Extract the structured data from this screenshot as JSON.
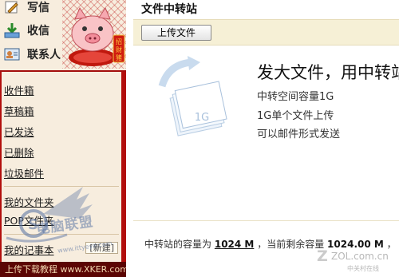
{
  "sidebar": {
    "actions": [
      {
        "label": "写信",
        "icon": "pencil-icon"
      },
      {
        "label": "收信",
        "icon": "inbox-download-icon"
      },
      {
        "label": "联系人",
        "icon": "contacts-icon"
      }
    ],
    "mascot": {
      "icon": "pig-mascot-icon",
      "sign": "招财猪"
    },
    "folders": [
      "收件箱",
      "草稿箱",
      "已发送",
      "已删除",
      "垃圾邮件"
    ],
    "extras": [
      "我的文件夹",
      "POP文件夹"
    ],
    "notebook": "我的记事本",
    "new_label": "[新建]",
    "footer": "上传下载教程 www.XKER.com"
  },
  "watermark": {
    "text": "电脑联盟",
    "url": "www.ittyeye.com"
  },
  "main": {
    "title": "文件中转站",
    "upload_button": "上传文件",
    "graphic_label": "1G",
    "promo": {
      "headline": "发大文件，用中转站",
      "lines": [
        "中转空间容量1G",
        "1G单个文件上传",
        "可以邮件形式发送"
      ]
    },
    "capacity": {
      "prefix": "中转站的容量为",
      "total": "1024 M",
      "middle": "，当前剩余容量",
      "remaining": "1024.00 M",
      "suffix": "，"
    },
    "logo": {
      "text": "ZOL.com.cn",
      "sub": "中关村在线"
    }
  },
  "colors": {
    "sidebar_red": "#b20f0d",
    "panel_bg": "#f7edde",
    "toolbar_bg": "#f6f0d6"
  }
}
